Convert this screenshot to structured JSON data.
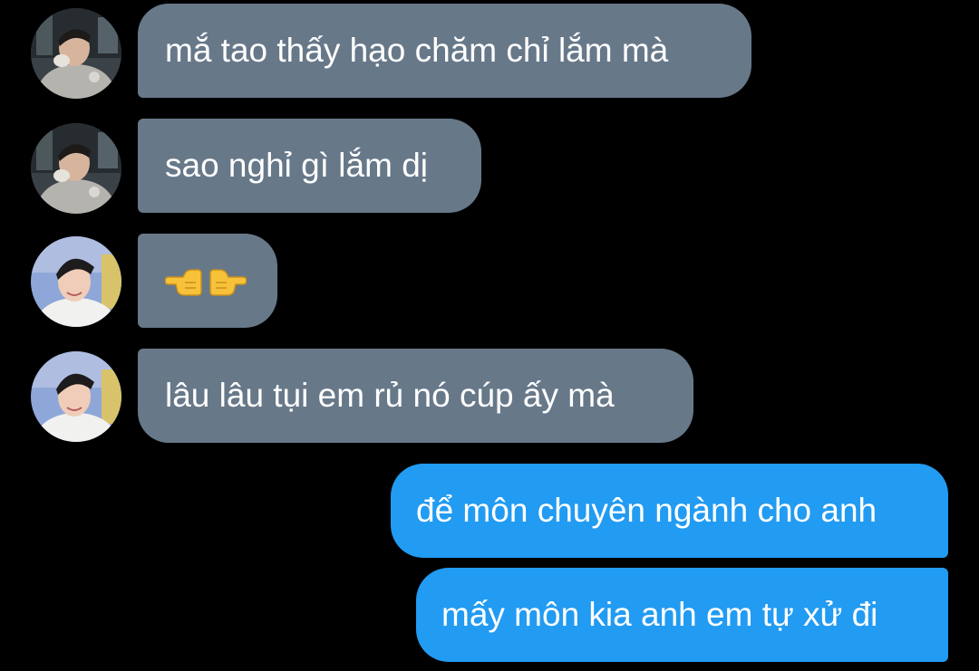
{
  "conversation": {
    "messages": [
      {
        "direction": "incoming",
        "sender_avatar": "avatar-a",
        "text": "mắ tao thấy hạo chăm chỉ lắm mà"
      },
      {
        "direction": "incoming",
        "sender_avatar": "avatar-a",
        "text": "sao nghỉ gì lắm dị"
      },
      {
        "direction": "incoming",
        "sender_avatar": "avatar-b",
        "text": "👉👉",
        "icon": "pointing-hands-emoji"
      },
      {
        "direction": "incoming",
        "sender_avatar": "avatar-b",
        "text": "lâu lâu tụi em rủ nó cúp ấy mà"
      },
      {
        "direction": "outgoing",
        "text": "để môn chuyên ngành cho anh"
      },
      {
        "direction": "outgoing",
        "text": "mấy môn kia anh em tự xử đi"
      }
    ]
  },
  "colors": {
    "background": "#000000",
    "incoming_bubble": "#677889",
    "outgoing_bubble": "#229bf2",
    "text": "#ffffff",
    "emoji": "#f7c23a"
  }
}
